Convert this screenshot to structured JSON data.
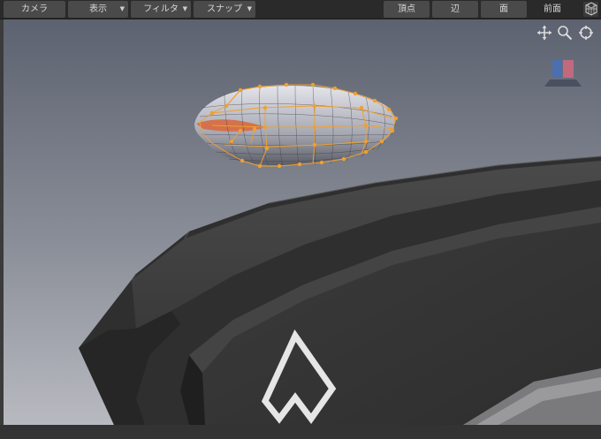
{
  "toolbar": {
    "camera_label": "カメラ",
    "display_label": "表示",
    "filter_label": "フィルタ",
    "snap_label": "スナップ",
    "vertex_label": "頂点",
    "edge_label": "辺",
    "face_label": "面",
    "view_label": "前面"
  },
  "icons": {
    "move": "move-icon",
    "zoom": "magnifier-icon",
    "rotate": "orbit-icon",
    "orientation": "view-cube-icon",
    "grid_toggle": "cube-grid-icon"
  },
  "colors": {
    "selection": "#f0a030",
    "selected_face": "#d86a40",
    "viewport_top": "#5f6470",
    "viewport_bottom": "#b3b6bc",
    "mesh": "#3a3a3a"
  }
}
